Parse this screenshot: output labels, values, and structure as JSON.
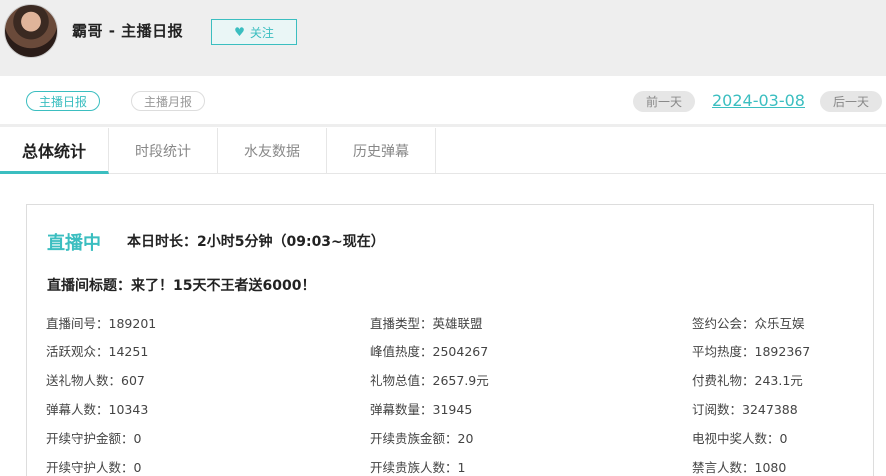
{
  "header": {
    "title": "霸哥 - 主播日报",
    "follow_label": "关注",
    "follow_icon": "heart-icon"
  },
  "report_tabs": [
    {
      "label": "主播日报",
      "active": true
    },
    {
      "label": "主播月报",
      "active": false
    }
  ],
  "date_nav": {
    "prev_label": "前一天",
    "date": "2024-03-08",
    "next_label": "后一天"
  },
  "tabs": [
    {
      "label": "总体统计",
      "active": true
    },
    {
      "label": "时段统计",
      "active": false
    },
    {
      "label": "水友数据",
      "active": false
    },
    {
      "label": "历史弹幕",
      "active": false
    }
  ],
  "live": {
    "status": "直播中",
    "duration_label": "本日时长：",
    "duration_value": "2小时5分钟（09:03~现在）",
    "title_label": "直播间标题：",
    "title_value": "来了！15天不王者送6000！"
  },
  "stats": [
    [
      {
        "label": "直播间号：",
        "value": "189201"
      },
      {
        "label": "直播类型：",
        "value": "英雄联盟"
      },
      {
        "label": "签约公会：",
        "value": "众乐互娱"
      }
    ],
    [
      {
        "label": "活跃观众：",
        "value": "14251"
      },
      {
        "label": "峰值热度：",
        "value": "2504267"
      },
      {
        "label": "平均热度：",
        "value": "1892367"
      }
    ],
    [
      {
        "label": "送礼物人数：",
        "value": "607"
      },
      {
        "label": "礼物总值：",
        "value": "2657.9元"
      },
      {
        "label": "付费礼物：",
        "value": "243.1元"
      }
    ],
    [
      {
        "label": "弹幕人数：",
        "value": "10343"
      },
      {
        "label": "弹幕数量：",
        "value": "31945"
      },
      {
        "label": "订阅数：",
        "value": "3247388"
      }
    ],
    [
      {
        "label": "开续守护金额：",
        "value": "0"
      },
      {
        "label": "开续贵族金额：",
        "value": "20"
      },
      {
        "label": "电视中奖人数：",
        "value": "0"
      }
    ],
    [
      {
        "label": "开续守护人数：",
        "value": "0"
      },
      {
        "label": "开续贵族人数：",
        "value": "1"
      },
      {
        "label": "禁言人数：",
        "value": "1080"
      }
    ]
  ],
  "colors": {
    "accent": "#3bbec0",
    "header_bg": "#eeeeee"
  }
}
